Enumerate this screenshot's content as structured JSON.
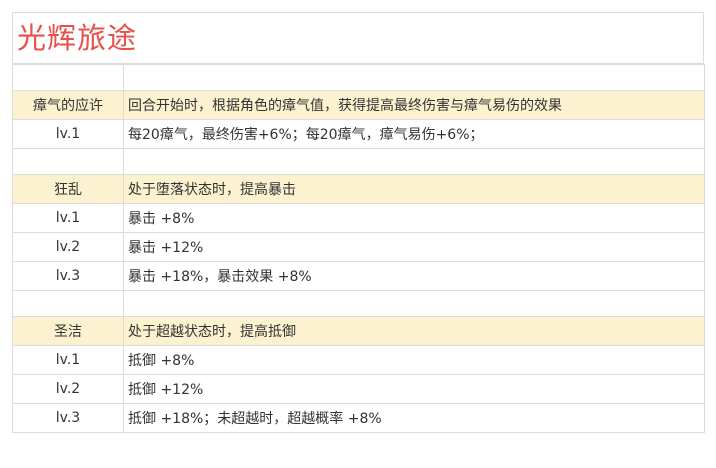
{
  "title": "光辉旅途",
  "sections": [
    {
      "name": "瘴气的应许",
      "description": "回合开始时，根据角色的瘴气值，获得提高最终伤害与瘴气易伤的效果",
      "levels": [
        {
          "level": "lv.1",
          "effect": "每20瘴气，最终伤害+6%；每20瘴气，瘴气易伤+6%；"
        }
      ]
    },
    {
      "name": "狂乱",
      "description": "处于堕落状态时，提高暴击",
      "levels": [
        {
          "level": "lv.1",
          "effect": "暴击 +8%"
        },
        {
          "level": "lv.2",
          "effect": "暴击 +12%"
        },
        {
          "level": "lv.3",
          "effect": "暴击 +18%，暴击效果 +8%"
        }
      ]
    },
    {
      "name": "圣洁",
      "description": "处于超越状态时，提高抵御",
      "levels": [
        {
          "level": "lv.1",
          "effect": "抵御 +8%"
        },
        {
          "level": "lv.2",
          "effect": "抵御 +12%"
        },
        {
          "level": "lv.3",
          "effect": "抵御 +18%；未超越时，超越概率 +8%"
        }
      ]
    }
  ],
  "colors": {
    "title": "#e8504a",
    "header_fill": "#fdf2d0",
    "grid": "#dcdcdc"
  }
}
